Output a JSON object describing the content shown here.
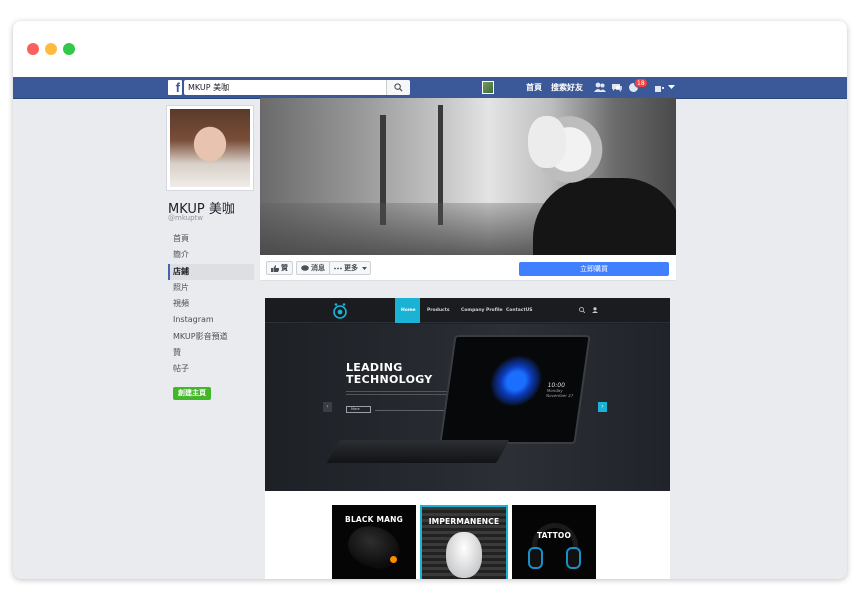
{
  "facebook_bar": {
    "logo": "f",
    "search_value": "MKUP 美咖",
    "nav_home": "首頁",
    "nav_find_friends": "搜索好友",
    "notification_count": "18"
  },
  "profile": {
    "name": "MKUP 美咖",
    "handle": "@mkuptw",
    "nav_items": [
      "首頁",
      "簡介",
      "店鋪",
      "照片",
      "視頻",
      "Instagram",
      "MKUP影音預道",
      "贊",
      "帖子"
    ],
    "active_index": 2,
    "create_page": "創建主頁"
  },
  "actions": {
    "like": "贊",
    "message": "消息",
    "more": "更多",
    "buy": "立即購買"
  },
  "website_preview": {
    "menu": [
      "Home",
      "Products",
      "Company Profile",
      "ContactUS"
    ],
    "hero_title_line1": "LEADING",
    "hero_title_line2": "TECHNOLOGY",
    "hero_more": "More",
    "tablet_time": "10:00",
    "tablet_day": "Monday",
    "tablet_date": "November 27",
    "thumbs": [
      "BLACK MANG",
      "IMPERMANENCE",
      "TATTOO"
    ],
    "accent_color": "#1ab3d6"
  },
  "colors": {
    "facebook_blue": "#3b5998",
    "buy_button": "#4080ff",
    "create_button": "#42b72a"
  }
}
